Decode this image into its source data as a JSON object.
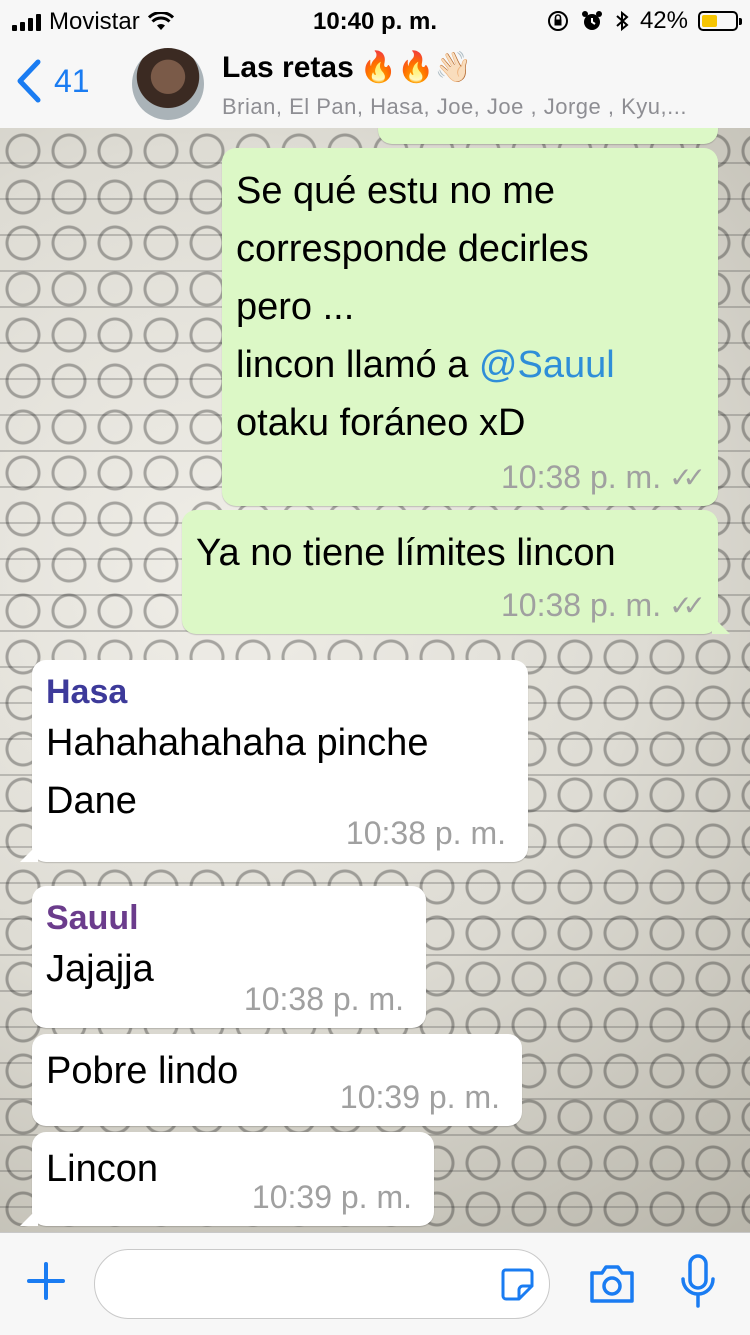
{
  "status_bar": {
    "carrier": "Movistar",
    "time": "10:40 p. m.",
    "battery": "42%",
    "battery_level": 0.42
  },
  "header": {
    "back_count": "41",
    "title": "Las retas",
    "title_emoji": "🔥🔥👋🏻",
    "subtitle": "Brian, El Pan, Hasa, Joe, Joe , Jorge , Kyu,..."
  },
  "messages": [
    {
      "direction": "out",
      "lines": [
        "Se qué estu no me",
        "corresponde decirles",
        "pero ...",
        "lincon llamó a ",
        "otaku foráneo xD"
      ],
      "mention": "@Sauul",
      "time": "10:38 p. m.",
      "status": "✓✓"
    },
    {
      "direction": "out",
      "text": "Ya no tiene límites lincon",
      "time": "10:38 p. m.",
      "status": "✓✓"
    },
    {
      "direction": "in",
      "sender": "Hasa",
      "sender_color": "#3d3a9a",
      "lines": [
        "Hahahahahaha pinche",
        "Dane"
      ],
      "time": "10:38 p. m."
    },
    {
      "direction": "in",
      "sender": "Sauul",
      "sender_color": "#6b3c8c",
      "text": "Jajajja",
      "time": "10:38 p. m."
    },
    {
      "direction": "in",
      "text": "Pobre lindo",
      "time": "10:39 p. m."
    },
    {
      "direction": "in",
      "text": "Lincon",
      "time": "10:39 p. m."
    }
  ],
  "input": {
    "placeholder": "",
    "value": ""
  },
  "colors": {
    "accent": "#1a7cf2",
    "outgoing_bubble": "#dcf8c6",
    "incoming_bubble": "#ffffff",
    "mention": "#2f8ed8"
  },
  "icons": [
    "back-chevron-icon",
    "plus-icon",
    "sticker-icon",
    "camera-icon",
    "microphone-icon",
    "wifi-icon",
    "signal-icon",
    "battery-icon"
  ]
}
